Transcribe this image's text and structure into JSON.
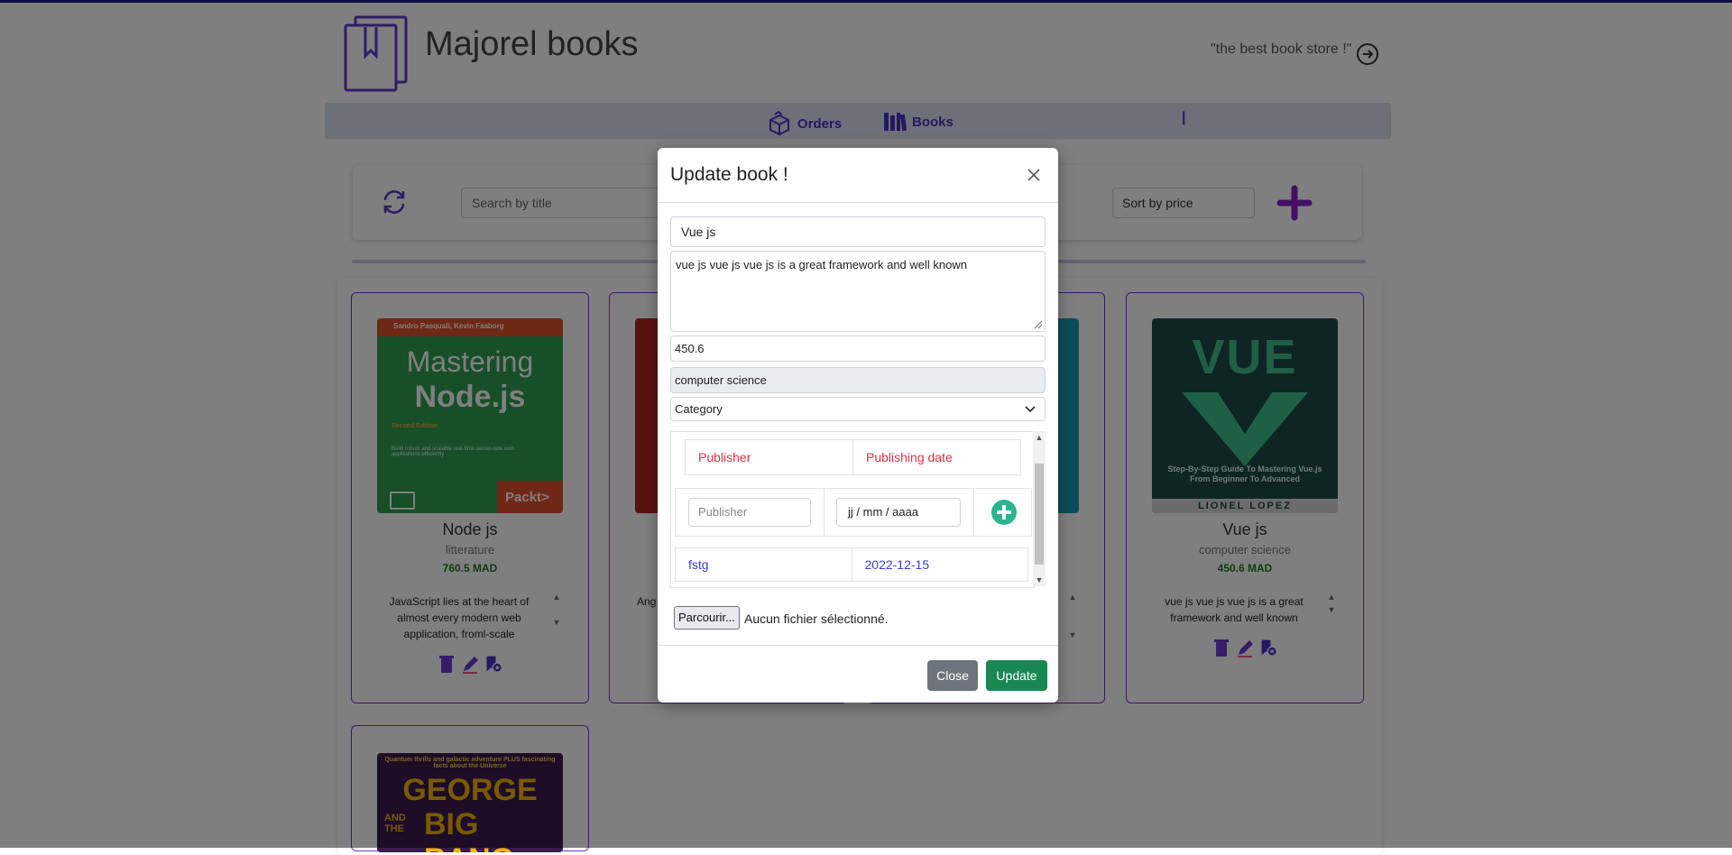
{
  "header": {
    "brand": "Majorel books",
    "tagline": "\"the best book store !\""
  },
  "nav": {
    "orders_label": "Orders",
    "separator": "|",
    "books_label": "Books"
  },
  "toolbar": {
    "search_placeholder": "Search by title",
    "sort_label": "Sort by price"
  },
  "books": [
    {
      "title": "Node js",
      "category": "litterature",
      "price": "760.5 MAD",
      "description": "JavaScript lies at the heart of almost every modern web application, froml-scale applications.",
      "cover": {
        "authors": "Sandro Pasquali, Kevin Faaborg",
        "line1": "Mastering",
        "line2": "Node.js",
        "edition": "Second Edition",
        "blurb": "Build robust and scalable real-time server-side web applications efficiently",
        "publisher": "Packt>"
      }
    },
    {
      "title": "",
      "category": "",
      "price": "",
      "description": "Ang"
    },
    {
      "title": "",
      "category": "",
      "price": "",
      "description": "n"
    },
    {
      "title": "Vue js",
      "category": "computer science",
      "price": "450.6 MAD",
      "description": "vue js vue js vue js is a great framework and well known",
      "cover": {
        "line1": "VUE",
        "subtitle": "Step-By-Step Guide To Mastering Vue.js From Beginner To Advanced",
        "author": "LIONEL LOPEZ"
      }
    },
    {
      "cover": {
        "tagline": "Quantum thrills and galactic adventure PLUS fascinating facts about the Universe",
        "line1": "GEORGE",
        "line2": "AND THE",
        "line3": "BIG BANG"
      }
    }
  ],
  "modal": {
    "title": "Update book !",
    "fields": {
      "title": "Vue js",
      "description": "vue js vue js vue js is a great framework and well known",
      "price": "450.6",
      "category": "computer science",
      "category_select": "Category"
    },
    "publishers": {
      "headers": [
        "Publisher",
        "Publishing date"
      ],
      "new_publisher_placeholder": "Publisher",
      "new_date_placeholder": "jj / mm / aaaa",
      "rows": [
        {
          "publisher": "fstg",
          "date": "2022-12-15"
        }
      ]
    },
    "file": {
      "button": "Parcourir...",
      "status": "Aucun fichier sélectionné."
    },
    "buttons": {
      "close": "Close",
      "update": "Update"
    }
  },
  "colors": {
    "accent": "#4b31c9",
    "add_plus": "#8a1fc8",
    "update_btn": "#198754",
    "close_btn": "#6c757d",
    "header_red": "#dc3545",
    "link_blue": "#3c3ce0"
  },
  "icons": [
    "logo-icon",
    "logout-icon",
    "orders-icon",
    "books-icon",
    "refresh-icon",
    "add-icon",
    "delete-icon",
    "edit-icon",
    "publisher-icon",
    "close-icon",
    "chevron-down-icon",
    "add-publisher-icon"
  ]
}
